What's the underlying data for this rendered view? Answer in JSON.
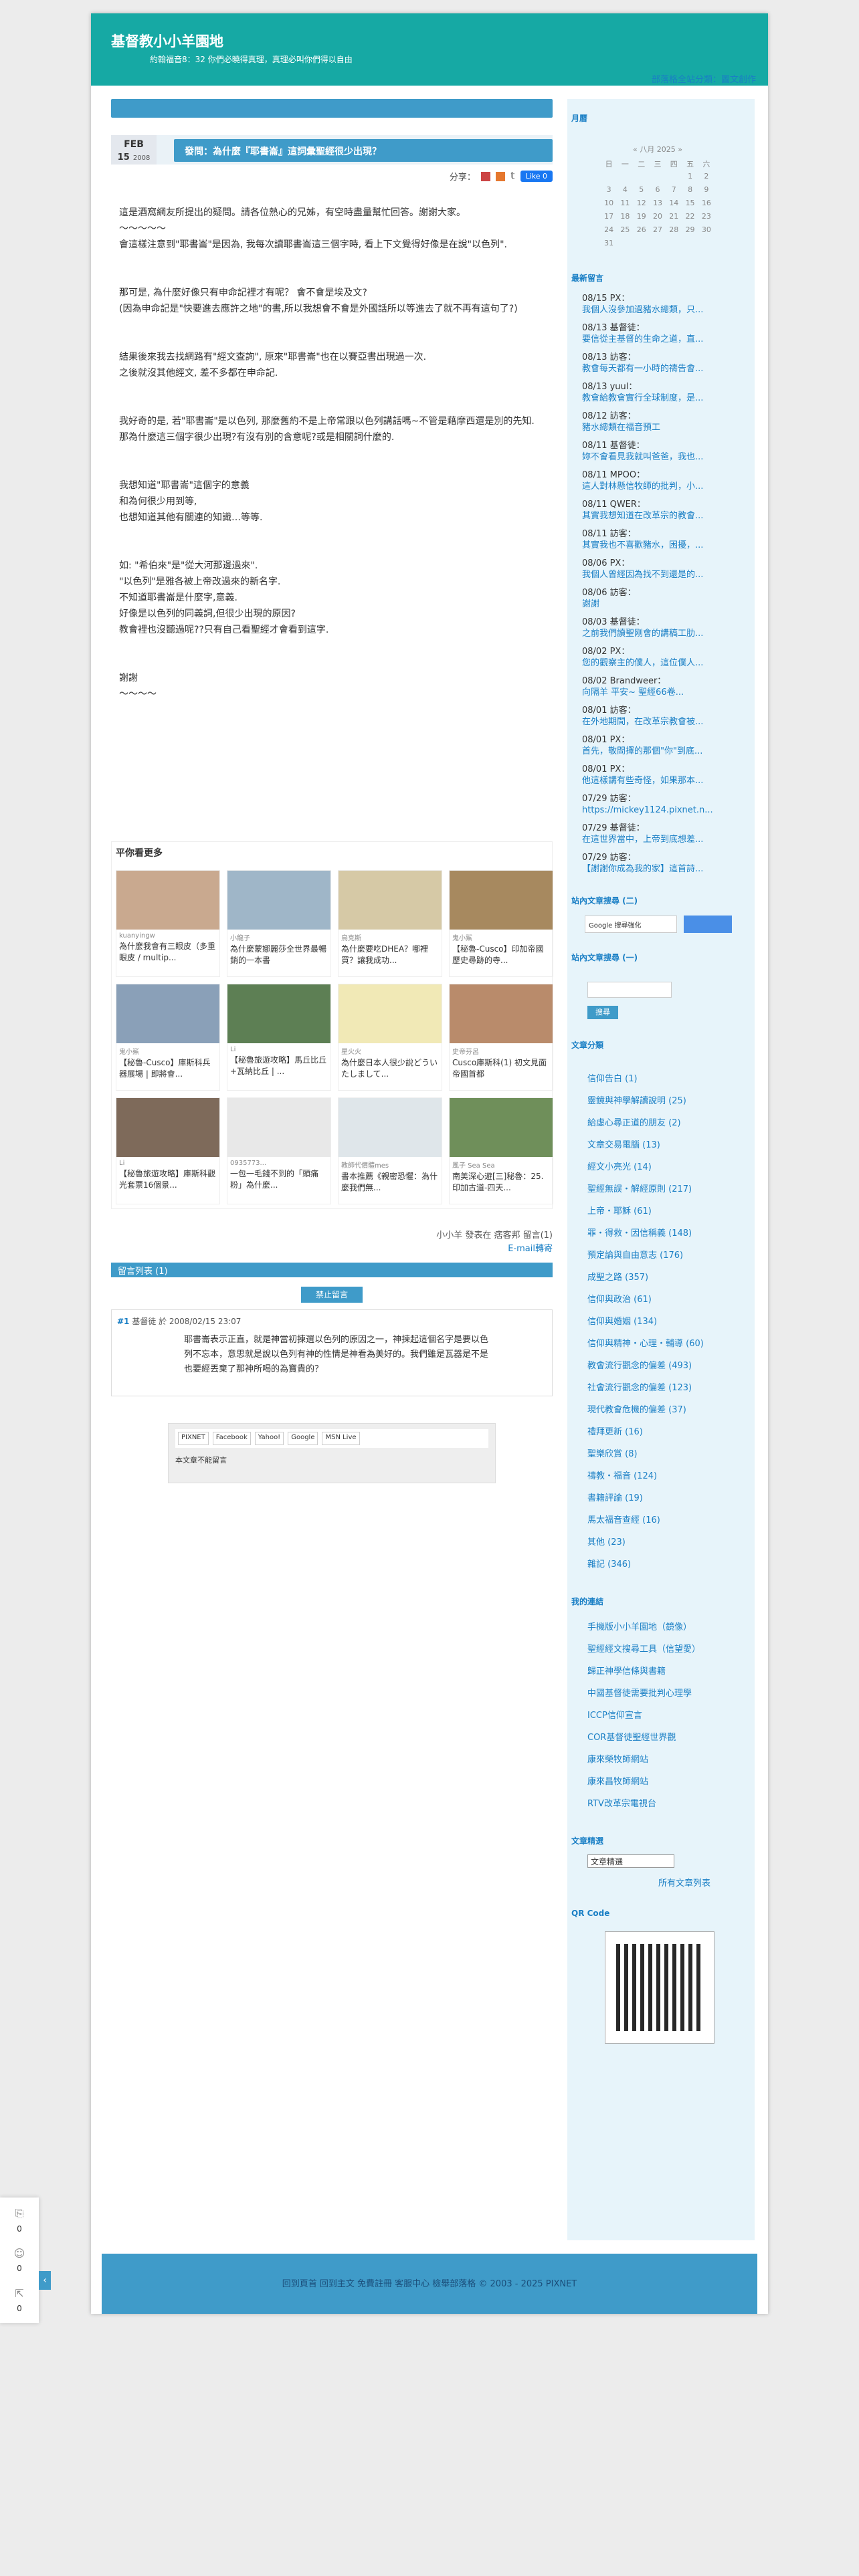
{
  "header": {
    "title": "基督教小小羊園地",
    "desc": "約翰福音8：32 你們必曉得真理，真理必叫你們得以自由",
    "nav": "部落格全站分類：圖文創作"
  },
  "post": {
    "month": "FEB",
    "day": "15",
    "year": "2008",
    "title": "發問：為什麼『耶書崙』這詞彙聖經很少出現？",
    "share_label": "分享：",
    "like": "Like 0"
  },
  "article": [
    "這是酒窩網友所提出的疑問。請各位熱心的兄姊，有空時盡量幫忙回答。謝謝大家。\n〜〜〜〜〜\n會這樣注意到\"耶書崙\"是因為, 我每次讀耶書崙這三個字時, 看上下文覺得好像是在說\"以色列\".",
    "那可是, 為什麼好像只有申命記裡才有呢？ 會不會是埃及文?\n(因為申命記是\"快要進去應許之地\"的書,所以我想會不會是外國話所以等進去了就不再有這句了?)",
    "結果後來我去找網路有\"經文查詢\", 原來\"耶書崙\"也在以賽亞書出現過一次.\n之後就沒其他經文, 差不多都在申命記.",
    "我好奇的是, 若\"耶書崙\"是以色列, 那麼舊約不是上帝常跟以色列講話嗎~不管是藉摩西還是別的先知.\n那為什麼這三個字很少出現?有沒有別的含意呢?或是相關詞什麼的.",
    "我想知道\"耶書崙\"這個字的意義\n和為何很少用到等,\n也想知道其他有關連的知識…等等.",
    "如: \"希伯來\"是\"從大河那邊過來\".\n\"以色列\"是雅各被上帝改過來的新名字.\n不知道耶書崙是什麼字,意義.\n好像是以色列的同義詞,但很少出現的原因?\n教會裡也沒聽過呢??只有自己看聖經才會看到這字.",
    "謝謝\n〜〜〜〜"
  ],
  "more": {
    "title": "平你看更多",
    "cards": [
      {
        "author": "kuanyingw",
        "title": "為什麼我會有三眼皮（多重眼皮 / multip..."
      },
      {
        "author": "小龍子",
        "title": "為什麼蒙娜麗莎全世界最暢銷的一本書"
      },
      {
        "author": "鳥克斯",
        "title": "為什麼要吃DHEA？哪裡買？讓我成功..."
      },
      {
        "author": "鬼小鯊",
        "title": "【秘魯-Cusco】印加帝國歷史尋跡的寺..."
      },
      {
        "author": "鬼小鯊",
        "title": "【秘魯-Cusco】庫斯科兵器展場 | 即將會..."
      },
      {
        "author": "Li",
        "title": "【秘魯旅遊攻略】馬丘比丘+瓦納比丘 | ..."
      },
      {
        "author": "星火火",
        "title": "為什麼日本人很少說どういたしまして..."
      },
      {
        "author": "史帝芬呂",
        "title": "Cusco庫斯科(1) 初文見面 帝國首都"
      },
      {
        "author": "Li",
        "title": "【秘魯旅遊攻略】庫斯科觀光套票16個景..."
      },
      {
        "author": "0935773...",
        "title": "一包一毛錢不到的「頭痛粉」為什麼..."
      },
      {
        "author": "教師代價體mes",
        "title": "書本推薦《親密恐懼：為什麼我們無..."
      },
      {
        "author": "風子 Sea Sea",
        "title": "南美深心遊[三]秘魯：25. 印加古道-四天..."
      }
    ]
  },
  "postfoot": {
    "line1": "小小羊 發表在 痞客邦 留言(1)",
    "line2": "E-mail轉寄"
  },
  "comments": {
    "bar": "留言列表 (1)",
    "stop": "禁止留言",
    "num": "#1",
    "header": "基督徒 於 2008/02/15 23:07",
    "body": "耶書崙表示正直，就是神當初揀選以色列的原因之一，神揀起這個名字是要以色列不忘本，意思就是說以色列有神的性情是神看為美好的。我們雖是瓦器是不是也要經丟棄了那神所喝的為寶貴的？"
  },
  "logins": {
    "items": [
      "PIXNET",
      "Facebook",
      "Yahoo!",
      "Google",
      "MSN Live"
    ],
    "note": "本文章不能留言"
  },
  "sidebar": {
    "month_title": "月曆",
    "cal_head": "«  八月 2025  »",
    "cal": [
      [
        "日",
        "一",
        "二",
        "三",
        "四",
        "五",
        "六"
      ],
      [
        "",
        "",
        "",
        "",
        "",
        "1",
        "2"
      ],
      [
        "3",
        "4",
        "5",
        "6",
        "7",
        "8",
        "9"
      ],
      [
        "10",
        "11",
        "12",
        "13",
        "14",
        "15",
        "16"
      ],
      [
        "17",
        "18",
        "19",
        "20",
        "21",
        "22",
        "23"
      ],
      [
        "24",
        "25",
        "26",
        "27",
        "28",
        "29",
        "30"
      ],
      [
        "31",
        "",
        "",
        "",
        "",
        "",
        ""
      ]
    ],
    "recent_title": "最新留言",
    "recent": [
      {
        "a": "08/15 PX：",
        "b": "我個人沒參加過豬水總類，只..."
      },
      {
        "a": "08/13 基督徒：",
        "b": "要信從主基督的生命之道，直..."
      },
      {
        "a": "08/13 訪客：",
        "b": "教會每天都有一小時的禱告會..."
      },
      {
        "a": "08/13 yuul：",
        "b": "教會給教會實行全球制度，是..."
      },
      {
        "a": "08/12 訪客：",
        "b": "豬水總類在福音預工"
      },
      {
        "a": "08/11 基督徒：",
        "b": "妳不會看見我就叫爸爸，我也..."
      },
      {
        "a": "08/11 MPOO：",
        "b": "這人對林懸信牧師的批判，小..."
      },
      {
        "a": "08/11 QWER：",
        "b": "其實我想知道在改革宗的教會..."
      },
      {
        "a": "08/11 訪客：",
        "b": "其實我也不喜歡豬水，困擾，..."
      },
      {
        "a": "08/06 PX：",
        "b": "我個人曾經因為找不到還是的..."
      },
      {
        "a": "08/06 訪客：",
        "b": "謝謝"
      },
      {
        "a": "08/03 基督徒：",
        "b": "之前我們讀聖刚會的講稿工肋..."
      },
      {
        "a": "08/02 PX：",
        "b": "您的觀察主的僕人，這位僕人..."
      },
      {
        "a": "08/02 Brandweer：",
        "b": "向隔羊 平安~ 聖經66卷..."
      },
      {
        "a": "08/01 訪客：",
        "b": "在外地期間，在改革宗教會被..."
      },
      {
        "a": "08/01 PX：",
        "b": "首先，敬問擇的那個\"你\"到底..."
      },
      {
        "a": "08/01 PX：",
        "b": "他這樣講有些奇怪，如果那本..."
      },
      {
        "a": "07/29 訪客：",
        "b": "https://mickey1124.pixnet.n..."
      },
      {
        "a": "07/29 基督徒：",
        "b": "在這世界當中，上帝到底想差..."
      },
      {
        "a": "07/29 訪客：",
        "b": "【謝謝你成為我的家】這首詩..."
      }
    ],
    "search1_title": "站內文章搜尋 (二)",
    "google": "Google 搜尋強化",
    "search2_title": "站內文章搜尋 (一)",
    "search2_btn": "搜尋",
    "cat_title": "文章分類",
    "cats": [
      "信仰告白 (1)",
      "靈鏡與神學解讀說明 (25)",
      "給虛心尋正道的朋友 (2)",
      "文章交易電腦 (13)",
      "經文小亮光 (14)",
      "聖經無誤・解經原則 (217)",
      "上帝・耶穌 (61)",
      "罪・得救・因信稱義 (148)",
      "預定論與自由意志 (176)",
      "成聖之路 (357)",
      "信仰與政治 (61)",
      "信仰與婚姻 (134)",
      "信仰與精神・心理・輔導 (60)",
      "教會流行觀念的偏差 (493)",
      "社會流行觀念的偏差 (123)",
      "現代教會危機的偏差 (37)",
      "禮拜更新 (16)",
      "聖樂欣賞 (8)",
      "禱教・福音 (124)",
      "書籍評論 (19)",
      "馬太福音查經 (16)",
      "其他 (23)",
      "雜記 (346)"
    ],
    "links_title": "我的連結",
    "links": [
      "手機版小小羊園地（鏡像）",
      "聖經經文搜尋工具（信望愛）",
      "歸正神學信條與書籍",
      "中國基督徒需要批判心理學",
      "ICCP信仰宣言",
      "COR基督徒聖經世界觀",
      "康來榮牧師網站",
      "康來昌牧師網站",
      "RTV改革宗電視台"
    ],
    "archive_title": "文章精選",
    "archive_sel": "文章精選",
    "all_posts": "所有文章列表",
    "qr_title": "QR Code"
  },
  "footer": {
    "text": "回到頁首 回到主文 免費註冊 客服中心 檢舉部落格 © 2003 - 2025 PIXNET"
  },
  "floating": {
    "a": "0",
    "b": "0",
    "c": "0"
  }
}
